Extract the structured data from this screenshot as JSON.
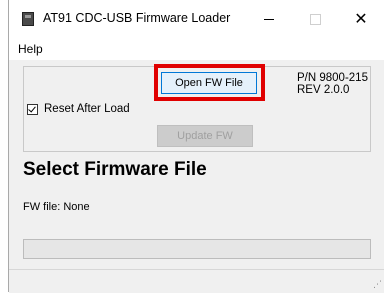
{
  "window": {
    "title": "AT91 CDC-USB Firmware Loader",
    "icon": "app-icon",
    "controls": {
      "minimize_icon": "minimize-icon",
      "maximize_icon": "maximize-icon",
      "close_icon": "close-icon",
      "close_glyph": "✕"
    }
  },
  "menu": {
    "items": [
      "Help"
    ]
  },
  "controls_group": {
    "open_button_label": "Open FW File",
    "update_button_label": "Update FW",
    "update_enabled": false,
    "reset_after_load_label": "Reset After Load",
    "reset_after_load_checked": true,
    "part_number": "P/N 9800-215",
    "revision": "REV 2.0.0"
  },
  "main": {
    "heading": "Select Firmware File",
    "fw_file_text": "FW file: None"
  },
  "progress": {
    "value": 0
  },
  "status_bar": {
    "grip_glyph": "⋰"
  },
  "colors": {
    "highlight": "#e00000",
    "window_bg": "#f0f0f0",
    "button_focus_border": "#0078d7"
  }
}
